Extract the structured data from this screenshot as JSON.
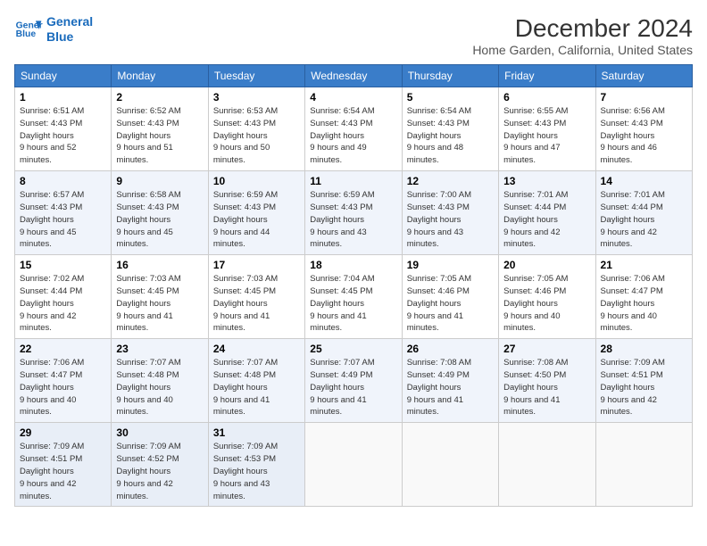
{
  "header": {
    "logo_line1": "General",
    "logo_line2": "Blue",
    "main_title": "December 2024",
    "subtitle": "Home Garden, California, United States"
  },
  "weekdays": [
    "Sunday",
    "Monday",
    "Tuesday",
    "Wednesday",
    "Thursday",
    "Friday",
    "Saturday"
  ],
  "weeks": [
    [
      {
        "day": "1",
        "sunrise": "6:51 AM",
        "sunset": "4:43 PM",
        "daylight": "9 hours and 52 minutes."
      },
      {
        "day": "2",
        "sunrise": "6:52 AM",
        "sunset": "4:43 PM",
        "daylight": "9 hours and 51 minutes."
      },
      {
        "day": "3",
        "sunrise": "6:53 AM",
        "sunset": "4:43 PM",
        "daylight": "9 hours and 50 minutes."
      },
      {
        "day": "4",
        "sunrise": "6:54 AM",
        "sunset": "4:43 PM",
        "daylight": "9 hours and 49 minutes."
      },
      {
        "day": "5",
        "sunrise": "6:54 AM",
        "sunset": "4:43 PM",
        "daylight": "9 hours and 48 minutes."
      },
      {
        "day": "6",
        "sunrise": "6:55 AM",
        "sunset": "4:43 PM",
        "daylight": "9 hours and 47 minutes."
      },
      {
        "day": "7",
        "sunrise": "6:56 AM",
        "sunset": "4:43 PM",
        "daylight": "9 hours and 46 minutes."
      }
    ],
    [
      {
        "day": "8",
        "sunrise": "6:57 AM",
        "sunset": "4:43 PM",
        "daylight": "9 hours and 45 minutes."
      },
      {
        "day": "9",
        "sunrise": "6:58 AM",
        "sunset": "4:43 PM",
        "daylight": "9 hours and 45 minutes."
      },
      {
        "day": "10",
        "sunrise": "6:59 AM",
        "sunset": "4:43 PM",
        "daylight": "9 hours and 44 minutes."
      },
      {
        "day": "11",
        "sunrise": "6:59 AM",
        "sunset": "4:43 PM",
        "daylight": "9 hours and 43 minutes."
      },
      {
        "day": "12",
        "sunrise": "7:00 AM",
        "sunset": "4:43 PM",
        "daylight": "9 hours and 43 minutes."
      },
      {
        "day": "13",
        "sunrise": "7:01 AM",
        "sunset": "4:44 PM",
        "daylight": "9 hours and 42 minutes."
      },
      {
        "day": "14",
        "sunrise": "7:01 AM",
        "sunset": "4:44 PM",
        "daylight": "9 hours and 42 minutes."
      }
    ],
    [
      {
        "day": "15",
        "sunrise": "7:02 AM",
        "sunset": "4:44 PM",
        "daylight": "9 hours and 42 minutes."
      },
      {
        "day": "16",
        "sunrise": "7:03 AM",
        "sunset": "4:45 PM",
        "daylight": "9 hours and 41 minutes."
      },
      {
        "day": "17",
        "sunrise": "7:03 AM",
        "sunset": "4:45 PM",
        "daylight": "9 hours and 41 minutes."
      },
      {
        "day": "18",
        "sunrise": "7:04 AM",
        "sunset": "4:45 PM",
        "daylight": "9 hours and 41 minutes."
      },
      {
        "day": "19",
        "sunrise": "7:05 AM",
        "sunset": "4:46 PM",
        "daylight": "9 hours and 41 minutes."
      },
      {
        "day": "20",
        "sunrise": "7:05 AM",
        "sunset": "4:46 PM",
        "daylight": "9 hours and 40 minutes."
      },
      {
        "day": "21",
        "sunrise": "7:06 AM",
        "sunset": "4:47 PM",
        "daylight": "9 hours and 40 minutes."
      }
    ],
    [
      {
        "day": "22",
        "sunrise": "7:06 AM",
        "sunset": "4:47 PM",
        "daylight": "9 hours and 40 minutes."
      },
      {
        "day": "23",
        "sunrise": "7:07 AM",
        "sunset": "4:48 PM",
        "daylight": "9 hours and 40 minutes."
      },
      {
        "day": "24",
        "sunrise": "7:07 AM",
        "sunset": "4:48 PM",
        "daylight": "9 hours and 41 minutes."
      },
      {
        "day": "25",
        "sunrise": "7:07 AM",
        "sunset": "4:49 PM",
        "daylight": "9 hours and 41 minutes."
      },
      {
        "day": "26",
        "sunrise": "7:08 AM",
        "sunset": "4:49 PM",
        "daylight": "9 hours and 41 minutes."
      },
      {
        "day": "27",
        "sunrise": "7:08 AM",
        "sunset": "4:50 PM",
        "daylight": "9 hours and 41 minutes."
      },
      {
        "day": "28",
        "sunrise": "7:09 AM",
        "sunset": "4:51 PM",
        "daylight": "9 hours and 42 minutes."
      }
    ],
    [
      {
        "day": "29",
        "sunrise": "7:09 AM",
        "sunset": "4:51 PM",
        "daylight": "9 hours and 42 minutes."
      },
      {
        "day": "30",
        "sunrise": "7:09 AM",
        "sunset": "4:52 PM",
        "daylight": "9 hours and 42 minutes."
      },
      {
        "day": "31",
        "sunrise": "7:09 AM",
        "sunset": "4:53 PM",
        "daylight": "9 hours and 43 minutes."
      },
      null,
      null,
      null,
      null
    ]
  ]
}
